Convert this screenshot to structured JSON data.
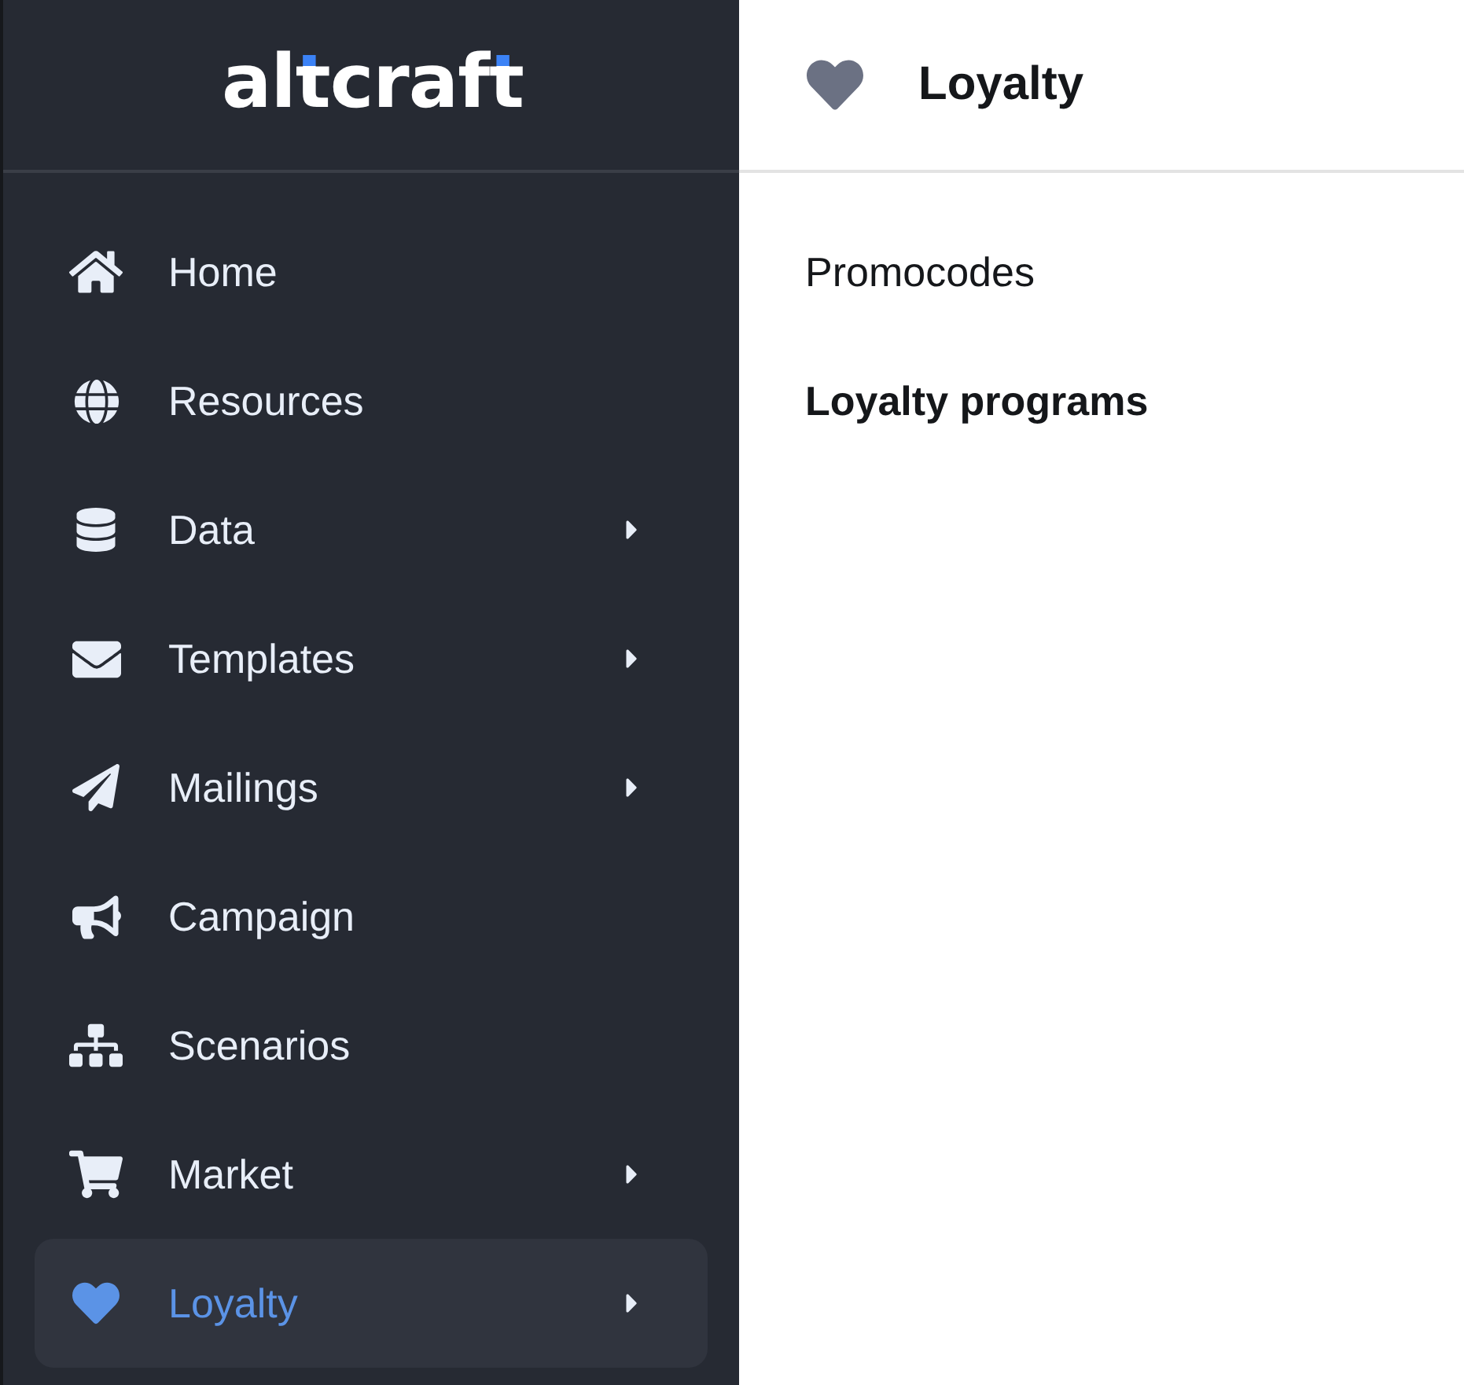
{
  "logo": {
    "parts": [
      {
        "text": "al",
        "accent": false
      },
      {
        "text": "t",
        "accent": true
      },
      {
        "text": "craf",
        "accent": false
      },
      {
        "text": "t",
        "accent": true
      }
    ]
  },
  "sidebar": {
    "items": [
      {
        "label": "Home",
        "has_submenu": false,
        "selected": false
      },
      {
        "label": "Resources",
        "has_submenu": false,
        "selected": false
      },
      {
        "label": "Data",
        "has_submenu": true,
        "selected": false
      },
      {
        "label": "Templates",
        "has_submenu": true,
        "selected": false
      },
      {
        "label": "Mailings",
        "has_submenu": true,
        "selected": false
      },
      {
        "label": "Campaign",
        "has_submenu": false,
        "selected": false
      },
      {
        "label": "Scenarios",
        "has_submenu": false,
        "selected": false
      },
      {
        "label": "Market",
        "has_submenu": true,
        "selected": false
      },
      {
        "label": "Loyalty",
        "has_submenu": true,
        "selected": true
      }
    ]
  },
  "header": {
    "title": "Loyalty"
  },
  "submenu": {
    "items": [
      {
        "label": "Promocodes",
        "selected": false
      },
      {
        "label": "Loyalty programs",
        "selected": true
      }
    ]
  }
}
